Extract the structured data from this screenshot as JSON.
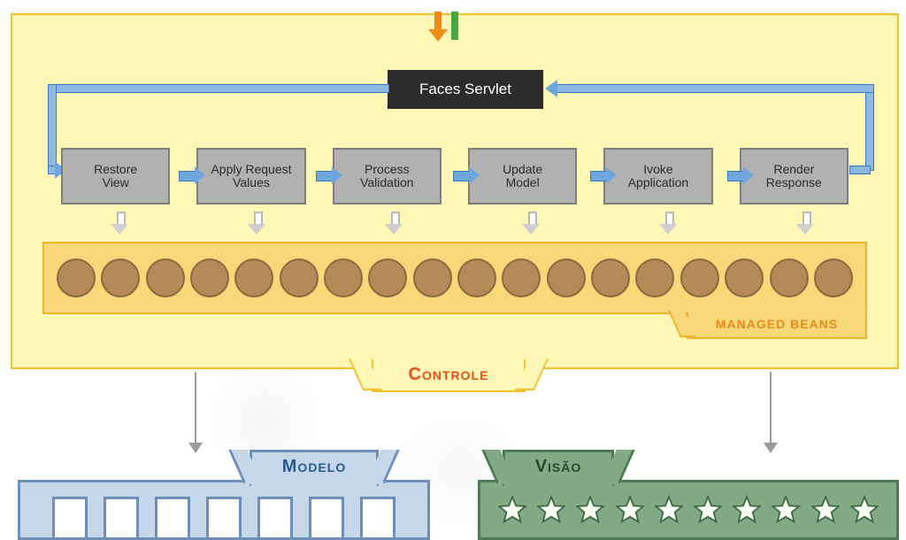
{
  "controle": {
    "label": "Controle",
    "faces_servlet": "Faces Servlet",
    "phases": [
      "Restore\nView",
      "Apply Request\nValues",
      "Process\nValidation",
      "Update\nModel",
      "Ivoke\nApplication",
      "Render\nResponse"
    ],
    "beans_label": "MANAGED BEANS",
    "bean_count": 18
  },
  "modelo": {
    "label": "Modelo",
    "cell_count": 7
  },
  "visao": {
    "label": "Visão",
    "star_count": 10
  },
  "colors": {
    "controle_bg": "#fef7b5",
    "controle_border": "#f3c12b",
    "controle_label": "#e94e1b",
    "phase_bg": "#b1b1b1",
    "arrow_blue": "#6fa6dd",
    "beans_bg": "#f8d97a",
    "bean_fill": "#b38a58",
    "modelo_bg": "#c7d7ea",
    "modelo_border": "#6c8fb7",
    "visao_bg": "#82ab85",
    "visao_border": "#4d7b54"
  }
}
